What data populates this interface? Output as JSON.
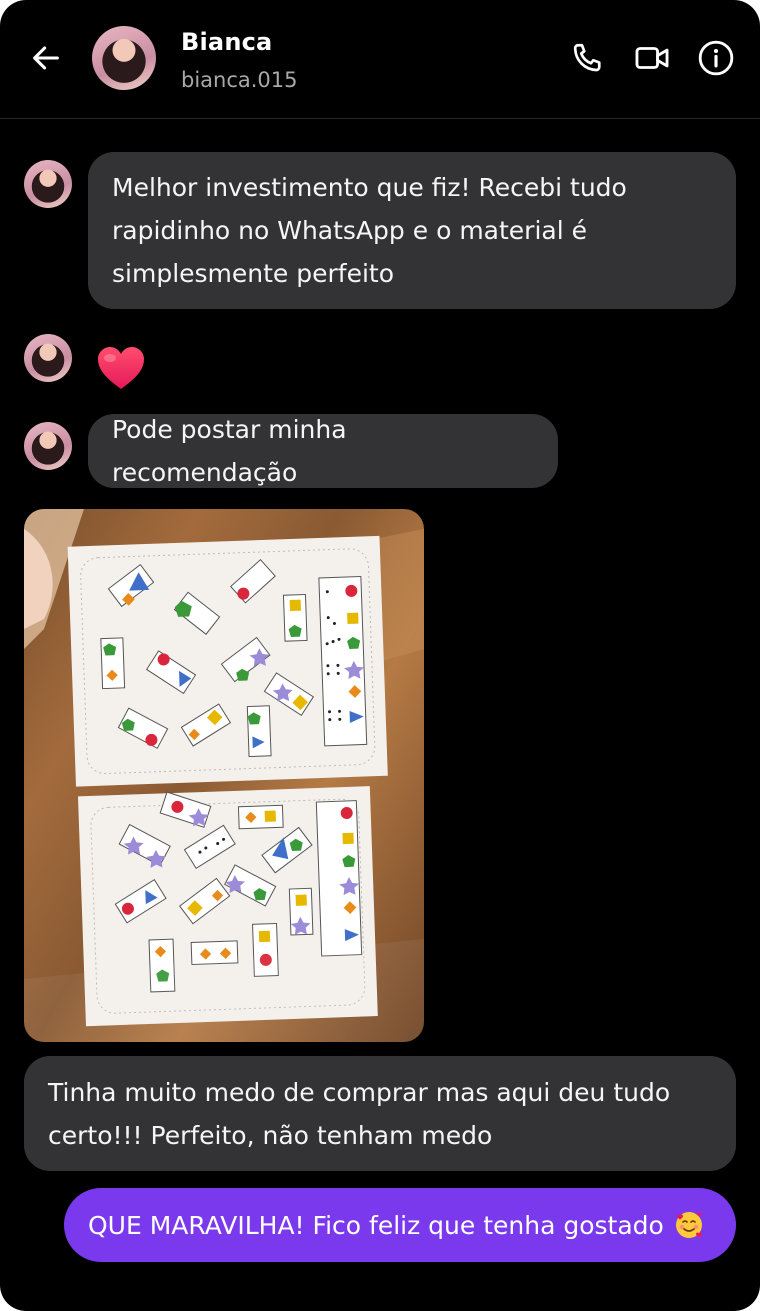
{
  "header": {
    "name": "Bianca",
    "handle": "bianca.015"
  },
  "messages": [
    {
      "from": "contact",
      "type": "text",
      "text": "Melhor investimento que fiz! Recebi tudo rapidinho no WhatsApp e o material é simplesmente perfeito"
    },
    {
      "from": "contact",
      "type": "reaction",
      "icon": "heart-icon",
      "color": "#f0335b"
    },
    {
      "from": "contact",
      "type": "text",
      "text": "Pode postar minha recomendação"
    },
    {
      "from": "contact",
      "type": "image",
      "description_icon": "domino-worksheet-photo"
    },
    {
      "from": "contact",
      "type": "text",
      "text": "Tinha muito medo de comprar mas aqui deu tudo certo!!! Perfeito, não tenham medo"
    },
    {
      "from": "me",
      "type": "text",
      "text": "QUE MARAVILHA! Fico feliz que tenha gostado",
      "emoji": "smiling-face-with-hearts-icon"
    }
  ],
  "colors": {
    "background": "#000000",
    "incoming_bubble": "#333336",
    "outgoing_bubble": "#7b39ed",
    "secondary_text": "#a8a8a8"
  }
}
